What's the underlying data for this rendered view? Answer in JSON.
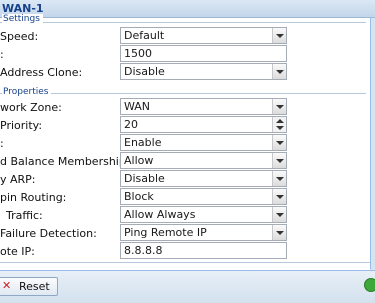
{
  "window": {
    "title": "WAN-1"
  },
  "sections": {
    "general": "Settings",
    "properties": "Properties"
  },
  "fields": {
    "link_speed": {
      "label": "Speed:",
      "value": "Default"
    },
    "mtu": {
      "label": ":",
      "value": "1500"
    },
    "mac_clone": {
      "label": "Address Clone:",
      "value": "Disable"
    },
    "network_zone": {
      "label": "work Zone:",
      "value": "WAN"
    },
    "priority": {
      "label": "Priority:",
      "value": "20"
    },
    "enable": {
      "label": ":",
      "value": "Enable"
    },
    "load_balance": {
      "label": "d Balance Membership:",
      "value": "Allow"
    },
    "proxy_arp": {
      "label": "y ARP:",
      "value": "Disable"
    },
    "hairpin": {
      "label": "pin Routing:",
      "value": "Block"
    },
    "traffic": {
      "label": "Traffic:",
      "value": "Allow Always"
    },
    "failure_detection": {
      "label": "Failure Detection:",
      "value": "Ping Remote IP"
    },
    "remote_ip": {
      "label": "ote IP:",
      "value": "8.8.8.8"
    }
  },
  "footer": {
    "reset_label": "Reset"
  }
}
